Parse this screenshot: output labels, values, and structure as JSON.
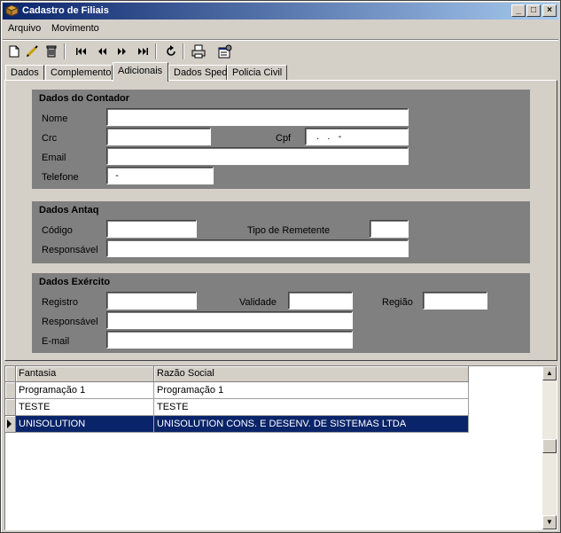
{
  "window": {
    "title": "Cadastro de Filiais"
  },
  "menu": {
    "items": [
      "Arquivo",
      "Movimento"
    ]
  },
  "tabs": [
    "Dados",
    "Complemento",
    "Adicionais",
    "Dados Sped",
    "Policia Civil"
  ],
  "contador": {
    "title": "Dados do Contador",
    "nome_label": "Nome",
    "nome_value": "",
    "crc_label": "Crc",
    "crc_value": "",
    "cpf_label": "Cpf",
    "cpf_value": "   .   .   -",
    "email_label": "Email",
    "email_value": "",
    "telefone_label": "Telefone",
    "telefone_value": "  -"
  },
  "antaq": {
    "title": "Dados Antaq",
    "codigo_label": "Código",
    "codigo_value": "",
    "tipo_label": "Tipo de Remetente",
    "tipo_value": "",
    "responsavel_label": "Responsável",
    "responsavel_value": ""
  },
  "exercito": {
    "title": "Dados Exército",
    "registro_label": "Registro",
    "registro_value": "",
    "validade_label": "Validade",
    "validade_value": "",
    "regiao_label": "Região",
    "regiao_value": "",
    "responsavel_label": "Responsável",
    "responsavel_value": "",
    "email_label": "E-mail",
    "email_value": ""
  },
  "grid": {
    "columns": [
      "Fantasia",
      "Razão Social"
    ],
    "rows": [
      [
        "Programação 1",
        "Programação 1"
      ],
      [
        "TESTE",
        "TESTE"
      ],
      [
        "UNISOLUTION",
        "UNISOLUTION CONS. E DESENV. DE SISTEMAS LTDA"
      ]
    ],
    "selected_row": 2
  },
  "colors": {
    "title_start": "#0a246a",
    "title_end": "#a6caf0",
    "group_bg": "#808080",
    "selection": "#0a246a"
  }
}
